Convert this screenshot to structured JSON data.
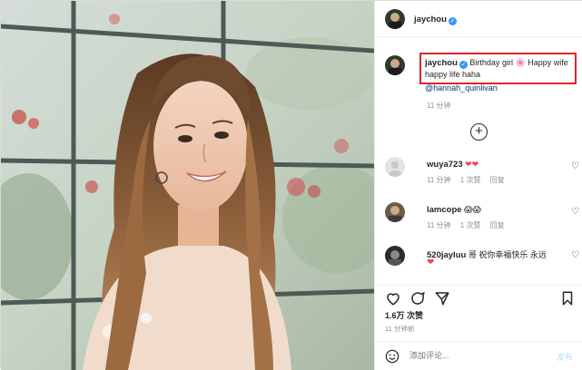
{
  "post": {
    "author": "jaychou",
    "caption_text": "Birthday girl",
    "caption_emoji": "🌸",
    "caption_text2": "Happy wife happy life haha",
    "mention": "@hannah_quinlivan",
    "caption_time": "11 分钟"
  },
  "comments": [
    {
      "user": "wuya723",
      "text": "❤❤",
      "time": "11 分钟",
      "likes": "1 次赞",
      "reply": "回复"
    },
    {
      "user": "lamcope",
      "text": "😱😱",
      "time": "11 分钟",
      "likes": "1 次赞",
      "reply": "回复"
    },
    {
      "user": "520jayluu",
      "text": "哥 祝你幸福快乐 永远",
      "text2": "❤"
    }
  ],
  "stats": {
    "likes": "1.6万 次赞",
    "time": "11 分钟前"
  },
  "composer": {
    "placeholder": "添加评论...",
    "publish": "发布"
  },
  "colors": {
    "verified": "#3897f0",
    "highlight_box": "#e0252b",
    "heart": "#ed4956",
    "link": "#00376b"
  },
  "icons": [
    "verified-icon",
    "add-icon",
    "heart-icon",
    "comment-icon",
    "share-icon",
    "bookmark-icon",
    "emoji-icon"
  ]
}
